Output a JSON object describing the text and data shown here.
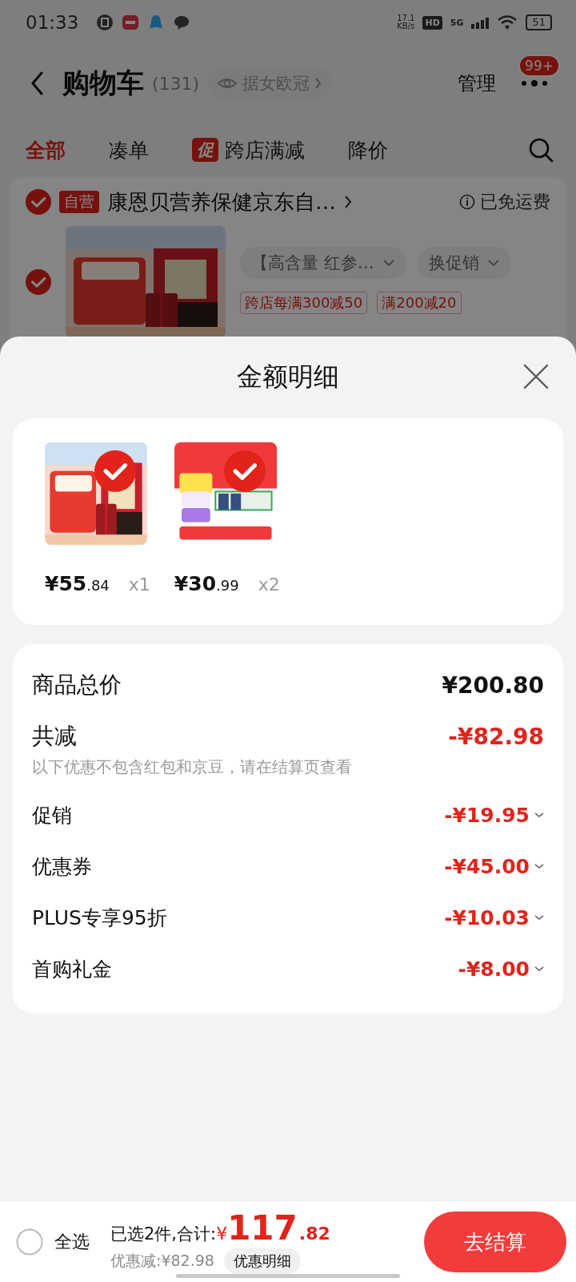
{
  "status_bar": {
    "time": "01:33",
    "speed": "17.1",
    "speed_unit": "KB/s",
    "hd": "HD",
    "network": "5G",
    "battery": "51"
  },
  "header": {
    "title": "购物车",
    "count": "(131)",
    "chip": "据女欧冠",
    "manage": "管理",
    "badge": "99+"
  },
  "tabs": [
    {
      "label": "全部",
      "selected": true,
      "kind": "text"
    },
    {
      "label": "凑单",
      "selected": false,
      "kind": "text"
    },
    {
      "label": "跨店满减",
      "selected": false,
      "kind": "promo",
      "tag": "促"
    },
    {
      "label": "降价",
      "selected": false,
      "kind": "text"
    }
  ],
  "store": {
    "checked": true,
    "tag": "自营",
    "name": "康恩贝营养保健京东自…",
    "shipping": "已免运费"
  },
  "product": {
    "checked": true,
    "spec": "【高含量 红参…",
    "promo_button": "换促销",
    "tags": [
      "跨店每满300减50",
      "满200减20"
    ]
  },
  "sheet": {
    "title": "金额明细",
    "items": [
      {
        "checked": true,
        "currency": "¥",
        "price_int": "55",
        "price_dec": ".84",
        "qty": "x1"
      },
      {
        "checked": true,
        "currency": "¥",
        "price_int": "30",
        "price_dec": ".99",
        "qty": "x2"
      }
    ],
    "summary": [
      {
        "kind": "total",
        "label": "商品总价",
        "value": "¥200.80"
      },
      {
        "kind": "reduction",
        "label": "共减",
        "value": "-¥82.98",
        "note": "以下优惠不包含红包和京豆，请在结算页查看"
      },
      {
        "kind": "discount",
        "label": "促销",
        "value": "-¥19.95"
      },
      {
        "kind": "discount",
        "label": "优惠券",
        "value": "-¥45.00"
      },
      {
        "kind": "discount",
        "label": "PLUS专享95折",
        "value": "-¥10.03"
      },
      {
        "kind": "discount",
        "label": "首购礼金",
        "value": "-¥8.00"
      }
    ]
  },
  "footer": {
    "select_all": {
      "label": "全选",
      "checked": false
    },
    "selected_text": "已选2件,合计:",
    "currency": "¥",
    "total_int": "117",
    "total_dec": ".82",
    "saved": "优惠减:¥82.98",
    "detail_button": "优惠明细",
    "checkout": "去结算"
  }
}
